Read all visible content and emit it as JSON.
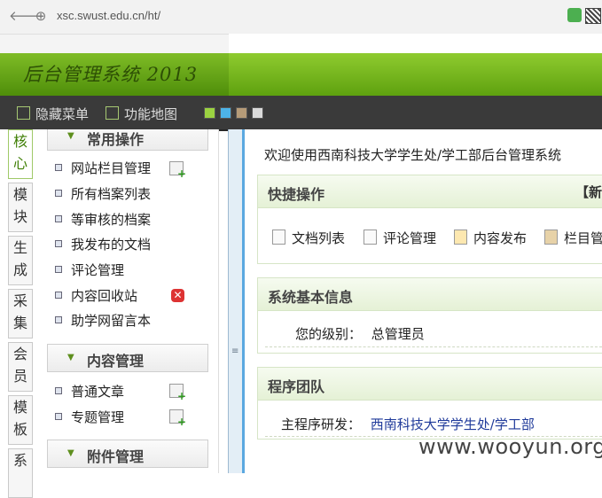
{
  "browser": {
    "url": "xsc.swust.edu.cn/ht/",
    "back_glyph": "🡐",
    "reload_glyph": "⊕"
  },
  "header": {
    "logo": "后台管理系统 2013"
  },
  "toolbar": {
    "hide_menu": "隐藏菜单",
    "site_map": "功能地图",
    "swatches": [
      "#9bd241",
      "#4db3e8",
      "#b59b78",
      "#d9d9d9"
    ]
  },
  "side_tabs": [
    "核心",
    "模块",
    "生成",
    "采集",
    "会员",
    "模板",
    "系"
  ],
  "menu": {
    "groups": [
      {
        "title": "常用操作",
        "items": [
          "网站栏目管理",
          "所有档案列表",
          "等审核的档案",
          "我发布的文档",
          "评论管理",
          "内容回收站",
          "助学网留言本"
        ]
      },
      {
        "title": "内容管理",
        "items": [
          "普通文章",
          "专题管理"
        ]
      },
      {
        "title": "附件管理",
        "items": []
      }
    ]
  },
  "main": {
    "welcome": "欢迎使用西南科技大学学生处/学工部后台管理系统",
    "quick": {
      "title": "快捷操作",
      "right_label": "【新",
      "actions": [
        "文档列表",
        "评论管理",
        "内容发布",
        "栏目管"
      ]
    },
    "sysinfo": {
      "title": "系统基本信息",
      "level_label": "您的级别：",
      "level_value": "总管理员"
    },
    "team": {
      "title": "程序团队",
      "dev_label": "主程序研发：",
      "dev_value": "西南科技大学学生处/学工部"
    }
  },
  "watermark": "www.wooyun.org",
  "colors": {
    "header_green": "#6aaa16",
    "toolbar_dark": "#3a3a3a",
    "link_blue": "#1f3a9a"
  }
}
